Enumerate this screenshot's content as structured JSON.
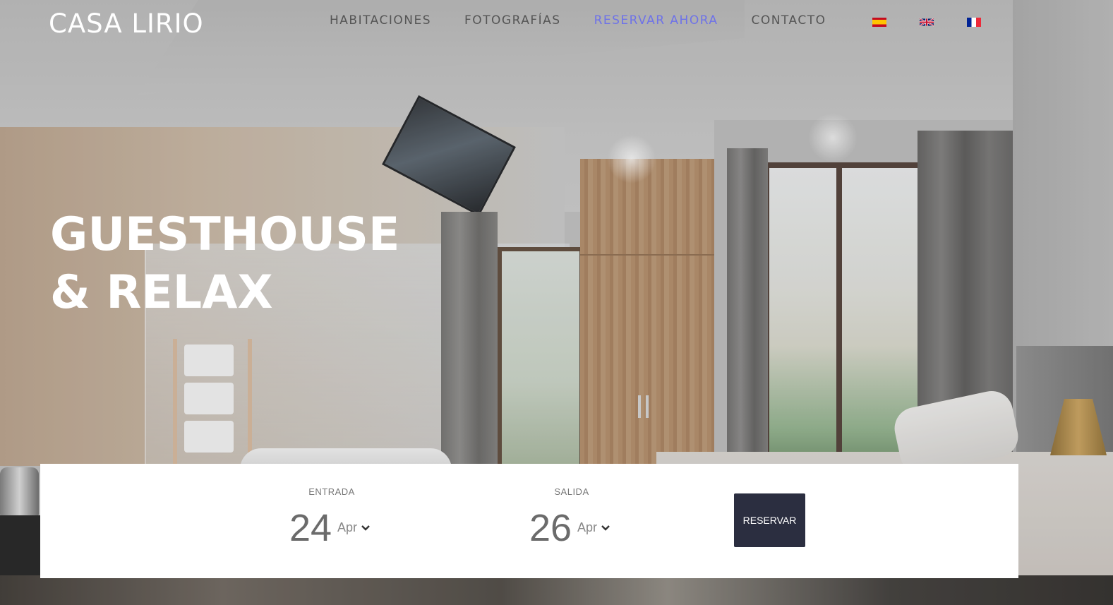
{
  "brand": {
    "name": "CASA LIRIO"
  },
  "nav": {
    "items": [
      {
        "label": "HABITACIONES",
        "active": false
      },
      {
        "label": "FOTOGRAFÍAS",
        "active": false
      },
      {
        "label": "RESERVAR AHORA",
        "active": true
      },
      {
        "label": "CONTACTO",
        "active": false
      }
    ],
    "languages": [
      {
        "icon": "spain-flag-icon"
      },
      {
        "icon": "uk-flag-icon"
      },
      {
        "icon": "france-flag-icon"
      }
    ]
  },
  "hero": {
    "line1": "GUESTHOUSE",
    "line2": "& RELAX"
  },
  "booking": {
    "checkin": {
      "label": "ENTRADA",
      "day": "24",
      "month": "Apr"
    },
    "checkout": {
      "label": "SALIDA",
      "day": "26",
      "month": "Apr"
    },
    "submit_label": "RESERVAR",
    "dropdown_icon": "chevron-down-icon"
  },
  "colors": {
    "accent": "#6e72e8",
    "nav_text": "#555555",
    "button_bg": "#2b2e40",
    "heading": "#ffffff"
  }
}
